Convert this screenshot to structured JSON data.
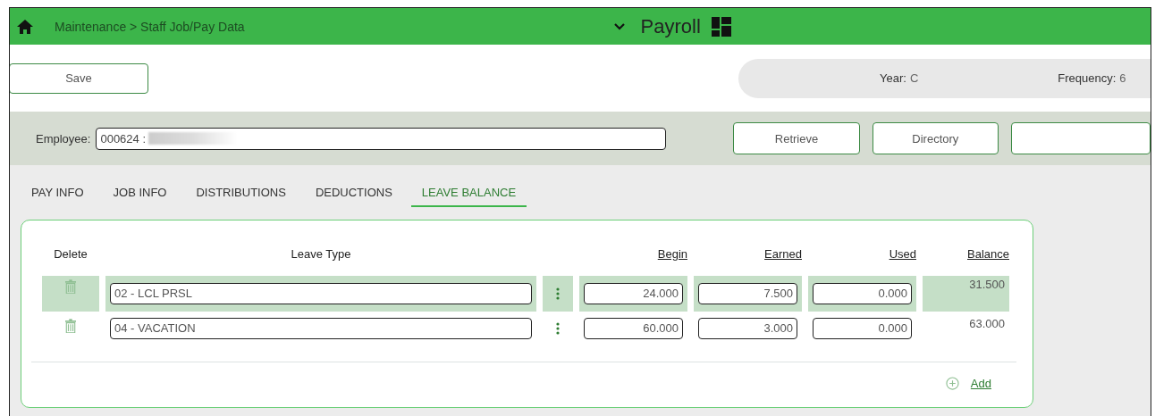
{
  "header": {
    "breadcrumb": "Maintenance > Staff Job/Pay Data",
    "module": "Payroll"
  },
  "toolbar": {
    "save": "Save",
    "year_label": "Year:",
    "year": "C",
    "frequency_label": "Frequency:",
    "frequency": "6"
  },
  "employee": {
    "label": "Employee:",
    "value": "000624 :",
    "name_redacted": true,
    "buttons": [
      "Retrieve",
      "Directory"
    ]
  },
  "tabs": [
    {
      "label": "PAY INFO",
      "selected": false
    },
    {
      "label": "JOB INFO",
      "selected": false
    },
    {
      "label": "DISTRIBUTIONS",
      "selected": false
    },
    {
      "label": "DEDUCTIONS",
      "selected": false
    },
    {
      "label": "LEAVE BALANCE",
      "selected": true
    }
  ],
  "table": {
    "columns": [
      "Delete",
      "Leave Type",
      "Begin",
      "Earned",
      "Used",
      "Balance"
    ],
    "rows": [
      {
        "selected": true,
        "leave_type": "02 - LCL PRSL",
        "begin": "24.000",
        "earned": "7.500",
        "used": "0.000",
        "balance": "31.500"
      },
      {
        "selected": false,
        "leave_type": "04 - VACATION",
        "begin": "60.000",
        "earned": "3.000",
        "used": "0.000",
        "balance": "63.000"
      }
    ],
    "add": "Add"
  }
}
